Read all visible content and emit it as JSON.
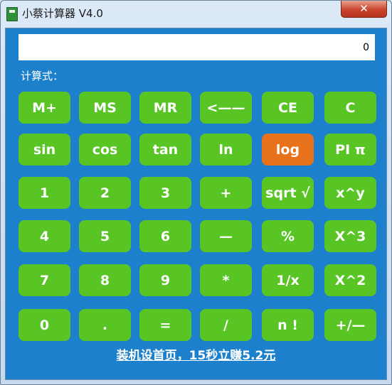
{
  "window": {
    "title": "小蔡计算器 V4.0",
    "close_glyph": "✕"
  },
  "display": {
    "value": "0"
  },
  "expression_label": "计算式：",
  "keys": [
    [
      "M+",
      "MS",
      "MR",
      "<——",
      "CE",
      "C"
    ],
    [
      "sin",
      "cos",
      "tan",
      "ln",
      "log",
      "PI π"
    ],
    [
      "1",
      "2",
      "3",
      "+",
      "sqrt √",
      "x^y"
    ],
    [
      "4",
      "5",
      "6",
      "—",
      "%",
      "X^3"
    ],
    [
      "7",
      "8",
      "9",
      "*",
      "1/x",
      "X^2"
    ],
    [
      "0",
      ".",
      "=",
      "/",
      "n !",
      "+/—"
    ]
  ],
  "highlighted_key": "log",
  "colors": {
    "background": "#1d80cc",
    "key": "#58c524",
    "key_highlight": "#e8721c"
  },
  "footer": {
    "link_text": "装机设首页，15秒立赚5.2元"
  },
  "icons": {
    "app": "calculator-app-icon",
    "close": "close-icon"
  }
}
